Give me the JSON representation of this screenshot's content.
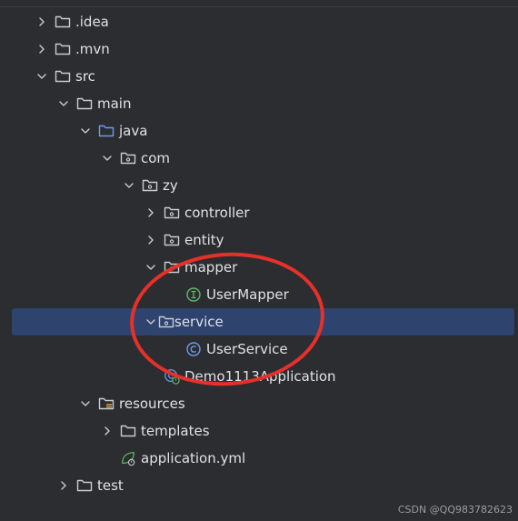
{
  "tree": {
    "items": [
      {
        "label": ".idea",
        "icon": "folder-icon",
        "arrow": "chevron-right-icon",
        "indent": 0
      },
      {
        "label": ".mvn",
        "icon": "folder-icon",
        "arrow": "chevron-right-icon",
        "indent": 0
      },
      {
        "label": "src",
        "icon": "folder-icon",
        "arrow": "chevron-down-icon",
        "indent": 0
      },
      {
        "label": "main",
        "icon": "folder-icon",
        "arrow": "chevron-down-icon",
        "indent": 1
      },
      {
        "label": "java",
        "icon": "source-folder-icon",
        "arrow": "chevron-down-icon",
        "indent": 2
      },
      {
        "label": "com",
        "icon": "package-icon",
        "arrow": "chevron-down-icon",
        "indent": 3
      },
      {
        "label": "zy",
        "icon": "package-icon",
        "arrow": "chevron-down-icon",
        "indent": 4
      },
      {
        "label": "controller",
        "icon": "package-icon",
        "arrow": "chevron-right-icon",
        "indent": 5
      },
      {
        "label": "entity",
        "icon": "package-icon",
        "arrow": "chevron-right-icon",
        "indent": 5
      },
      {
        "label": "mapper",
        "icon": "package-icon",
        "arrow": "chevron-down-icon",
        "indent": 5
      },
      {
        "label": "UserMapper",
        "icon": "interface-icon",
        "arrow": "",
        "indent": 6
      },
      {
        "label": "service",
        "icon": "package-icon",
        "arrow": "chevron-down-icon",
        "indent": 5,
        "selected": true
      },
      {
        "label": "UserService",
        "icon": "class-icon",
        "arrow": "",
        "indent": 6
      },
      {
        "label": "Demo1113Application",
        "icon": "spring-app-icon",
        "arrow": "",
        "indent": 5
      },
      {
        "label": "resources",
        "icon": "resources-folder-icon",
        "arrow": "chevron-down-icon",
        "indent": 2
      },
      {
        "label": "templates",
        "icon": "folder-icon",
        "arrow": "chevron-right-icon",
        "indent": 3
      },
      {
        "label": "application.yml",
        "icon": "spring-config-icon",
        "arrow": "",
        "indent": 3
      },
      {
        "label": "test",
        "icon": "folder-icon",
        "arrow": "chevron-right-icon",
        "indent": 1
      }
    ]
  },
  "watermark": "CSDN @QQ983782623",
  "colors": {
    "background": "#2b2d30",
    "selection": "#2e436e",
    "text": "#dfe1e5",
    "annotation_circle": "#e8302a",
    "interface_green": "#5fb865",
    "class_blue": "#6c9bf0",
    "java_folder_blue": "#6c9bf0"
  }
}
